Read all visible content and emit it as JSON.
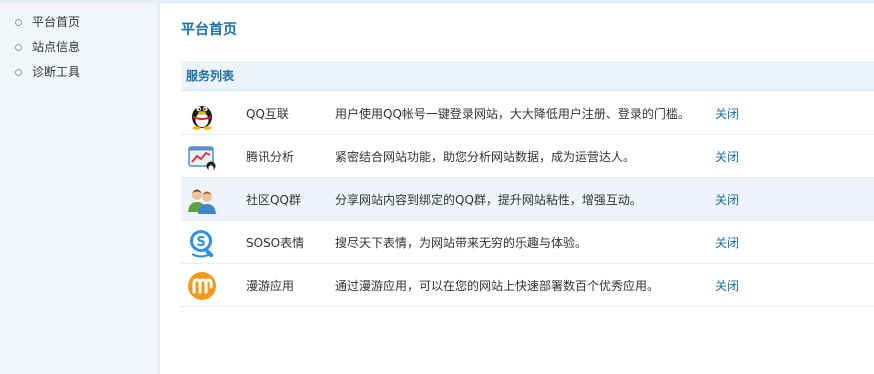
{
  "sidebar": {
    "items": [
      {
        "label": "平台首页"
      },
      {
        "label": "站点信息"
      },
      {
        "label": "诊断工具"
      }
    ]
  },
  "main": {
    "title": "平台首页",
    "section_title": "服务列表",
    "services": [
      {
        "icon": "qq-penguin-icon",
        "name": "QQ互联",
        "desc": "用户使用QQ帐号一键登录网站，大大降低用户注册、登录的门槛。",
        "action": "关闭"
      },
      {
        "icon": "analytics-chart-icon",
        "name": "腾讯分析",
        "desc": "紧密结合网站功能，助您分析网站数据，成为运营达人。",
        "action": "关闭"
      },
      {
        "icon": "qq-group-icon",
        "name": "社区QQ群",
        "desc": "分享网站内容到绑定的QQ群，提升网站粘性，增强互动。",
        "action": "关闭"
      },
      {
        "icon": "soso-emoticon-icon",
        "name": "SOSO表情",
        "desc": "搜尽天下表情，为网站带来无穷的乐趣与体验。",
        "action": "关闭"
      },
      {
        "icon": "manyou-app-icon",
        "name": "漫游应用",
        "desc": "通过漫游应用，可以在您的网站上快速部署数百个优秀应用。",
        "action": "关闭"
      }
    ]
  },
  "colors": {
    "accent": "#1e6fa3",
    "sidebar_bg": "#f2f6fb",
    "header_bg": "#ecf3fa",
    "row_alt_bg": "#eef4fa"
  }
}
